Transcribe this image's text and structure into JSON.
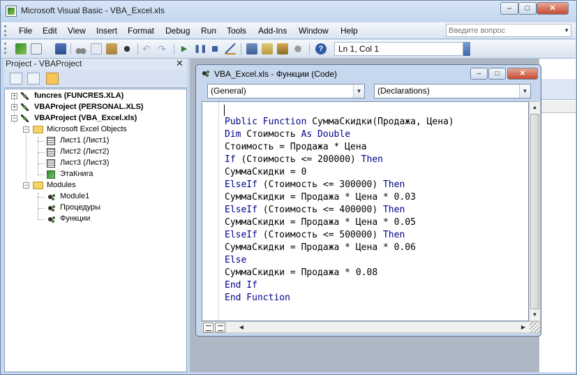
{
  "app": {
    "title": "Microsoft Visual Basic - VBA_Excel.xls",
    "minimize": "–",
    "maximize": "□",
    "close": "✕"
  },
  "menu": {
    "items": [
      "File",
      "Edit",
      "View",
      "Insert",
      "Format",
      "Debug",
      "Run",
      "Tools",
      "Add-Ins",
      "Window",
      "Help"
    ],
    "help_placeholder": "Введите вопрос"
  },
  "toolbar": {
    "icons": [
      "excel-view-icon",
      "insert-module-icon",
      "save-icon",
      "cut-icon",
      "copy-icon",
      "paste-icon",
      "find-icon",
      "undo-icon",
      "redo-icon",
      "run-icon",
      "break-icon",
      "reset-icon",
      "design-mode-icon",
      "project-explorer-icon",
      "properties-icon",
      "object-browser-icon",
      "toolbox-icon",
      "help-icon"
    ],
    "position": "Ln 1, Col 1"
  },
  "project": {
    "title": "Project - VBAProject",
    "close": "✕",
    "tree": {
      "funcres": "funcres (FUNCRES.XLA)",
      "personal": "VBAProject (PERSONAL.XLS)",
      "vba_excel": "VBAProject (VBA_Excel.xls)",
      "excel_objects": "Microsoft Excel Objects",
      "sheet1": "Лист1 (Лист1)",
      "sheet2": "Лист2 (Лист2)",
      "sheet3": "Лист3 (Лист3)",
      "this_workbook": "ЭтаКнига",
      "modules": "Modules",
      "module1": "Module1",
      "procedures": "Процедуры",
      "functions": "Функции"
    }
  },
  "code_window": {
    "title": "VBA_Excel.xls - Функции (Code)",
    "object_dropdown": "(General)",
    "proc_dropdown": "(Declarations)",
    "lines": [
      [
        {
          "t": "Public Function",
          "k": 1
        },
        {
          "t": " СуммаСкидки(Продажа, Цена)",
          "k": 0
        }
      ],
      [
        {
          "t": "Dim",
          "k": 1
        },
        {
          "t": " Стоимость ",
          "k": 0
        },
        {
          "t": "As Double",
          "k": 1
        }
      ],
      [
        {
          "t": "Стоимость = Продажа * Цена",
          "k": 0
        }
      ],
      [
        {
          "t": "If",
          "k": 1
        },
        {
          "t": " (Стоимость <= 200000) ",
          "k": 0
        },
        {
          "t": "Then",
          "k": 1
        }
      ],
      [
        {
          "t": "СуммаСкидки = 0",
          "k": 0
        }
      ],
      [
        {
          "t": "ElseIf",
          "k": 1
        },
        {
          "t": " (Стоимость <= 300000) ",
          "k": 0
        },
        {
          "t": "Then",
          "k": 1
        }
      ],
      [
        {
          "t": "СуммаСкидки = Продажа * Цена * 0.03",
          "k": 0
        }
      ],
      [
        {
          "t": "ElseIf",
          "k": 1
        },
        {
          "t": " (Стоимость <= 400000) ",
          "k": 0
        },
        {
          "t": "Then",
          "k": 1
        }
      ],
      [
        {
          "t": "СуммаСкидки = Продажа * Цена * 0.05",
          "k": 0
        }
      ],
      [
        {
          "t": "ElseIf",
          "k": 1
        },
        {
          "t": " (Стоимость <= 500000) ",
          "k": 0
        },
        {
          "t": "Then",
          "k": 1
        }
      ],
      [
        {
          "t": "СуммаСкидки = Продажа * Цена * 0.06",
          "k": 0
        }
      ],
      [
        {
          "t": "Else",
          "k": 1
        }
      ],
      [
        {
          "t": "СуммаСкидки = Продажа * 0.08",
          "k": 0
        }
      ],
      [
        {
          "t": "End If",
          "k": 1
        }
      ],
      [
        {
          "t": "End Function",
          "k": 1
        }
      ]
    ]
  },
  "colors": {
    "keyword": "#00008b",
    "window_frame": "#c4d7ee",
    "close_button": "#c74b2f"
  }
}
